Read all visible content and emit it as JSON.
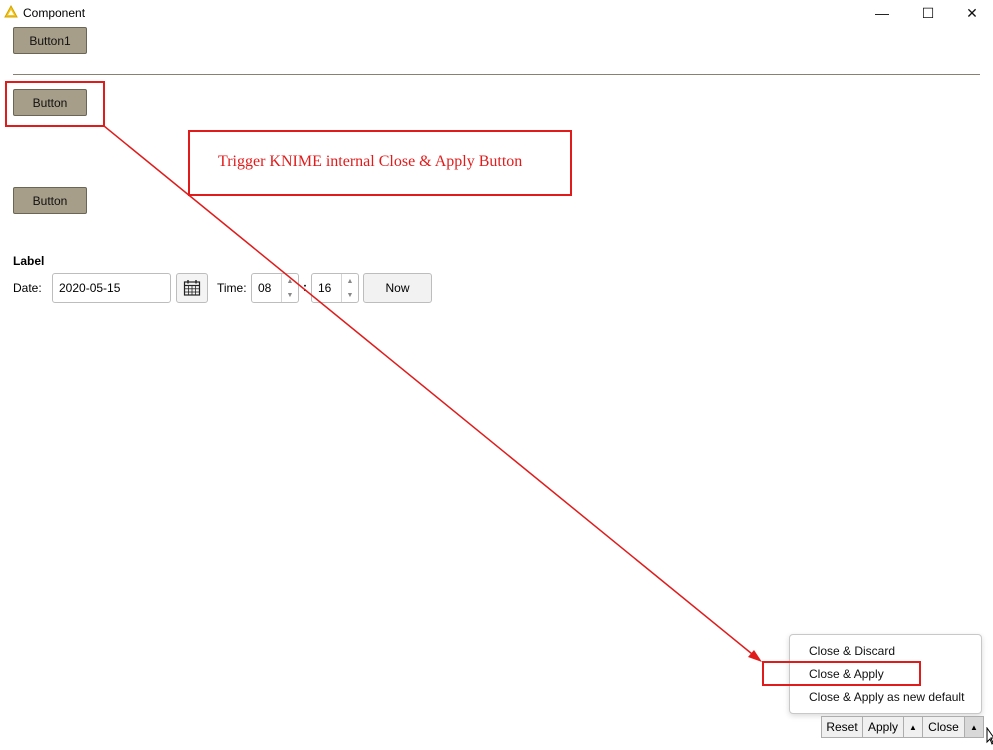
{
  "window": {
    "title": "Component",
    "minimize_glyph": "—",
    "maximize_glyph": "☐",
    "close_glyph": "✕",
    "icon": "knime-triangle-icon"
  },
  "buttons": {
    "button1": "Button1",
    "button_a": "Button",
    "button_b": "Button"
  },
  "annotation": {
    "text": "Trigger KNIME internal Close & Apply Button",
    "color": "#e01b1b"
  },
  "datetime": {
    "label": "Label",
    "date_label": "Date:",
    "date_value": "2020-05-15",
    "time_label": "Time:",
    "hour": "08",
    "separator": ":",
    "minute": "16",
    "now_label": "Now"
  },
  "close_menu": {
    "items": [
      "Close & Discard",
      "Close & Apply",
      "Close & Apply as new default"
    ],
    "highlighted_index": 1
  },
  "footer": {
    "reset": "Reset",
    "apply": "Apply",
    "close": "Close",
    "arrow_glyph": "▲"
  },
  "colors": {
    "knime_button": "#a79e8a",
    "accent_red": "#e01b1b"
  }
}
